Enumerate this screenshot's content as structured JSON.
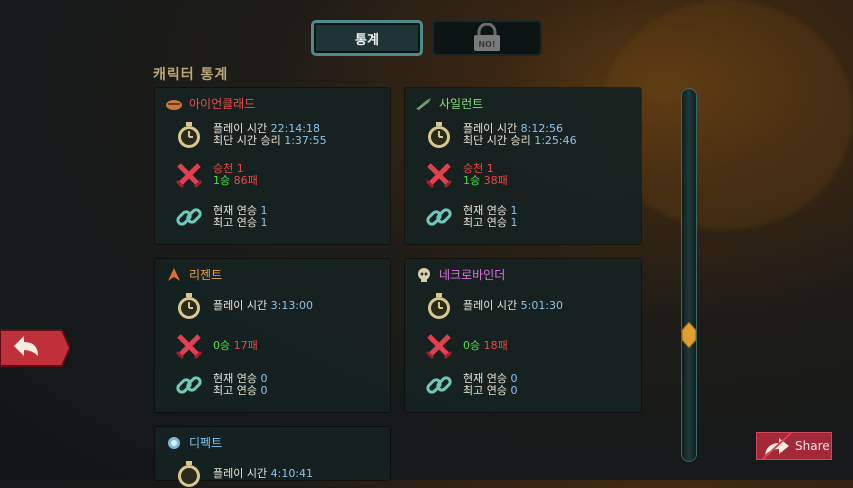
{
  "tabs": {
    "stats_label": "통계",
    "locked_badge": "NO!"
  },
  "section_title": "캐릭터 통계",
  "characters": [
    {
      "name": "아이언클래드",
      "name_color": "#e85050",
      "playtime_label": "플레이 시간",
      "playtime": "22:14:18",
      "fastest_label": "최단 시간 승리",
      "fastest": "1:37:55",
      "ascension_label": "승천 1",
      "wins": "1승",
      "losses": "86패",
      "streak_label": "현재 연승",
      "streak": "1",
      "best_streak_label": "최고 연승",
      "best_streak": "1"
    },
    {
      "name": "사일런트",
      "name_color": "#7fe07f",
      "playtime_label": "플레이 시간",
      "playtime": "8:12:56",
      "fastest_label": "최단 시간 승리",
      "fastest": "1:25:46",
      "ascension_label": "승천 1",
      "wins": "1승",
      "losses": "38패",
      "streak_label": "현재 연승",
      "streak": "1",
      "best_streak_label": "최고 연승",
      "best_streak": "1"
    },
    {
      "name": "리젠트",
      "name_color": "#f0a040",
      "playtime_label": "플레이 시간",
      "playtime": "3:13:00",
      "wins": "0승",
      "losses": "17패",
      "streak_label": "현재 연승",
      "streak": "0",
      "best_streak_label": "최고 연승",
      "best_streak": "0"
    },
    {
      "name": "네크로바인더",
      "name_color": "#e070e0",
      "playtime_label": "플레이 시간",
      "playtime": "5:01:30",
      "wins": "0승",
      "losses": "18패",
      "streak_label": "현재 연승",
      "streak": "0",
      "best_streak_label": "최고 연승",
      "best_streak": "0"
    },
    {
      "name": "디펙트",
      "name_color": "#80c8f0",
      "playtime_label": "플레이 시간",
      "playtime": "4:10:41"
    }
  ],
  "share_label": "Share",
  "icons": {
    "clock": "stopwatch-icon",
    "swords": "crossed-swords-icon",
    "chain": "chain-link-icon",
    "back": "back-arrow-icon",
    "share": "share-arrow-icon",
    "lock": "padlock-icon"
  },
  "colors": {
    "accent_teal": "#4f8b8b",
    "share_red": "#a2283a",
    "value_blue": "#8fc3e8"
  }
}
